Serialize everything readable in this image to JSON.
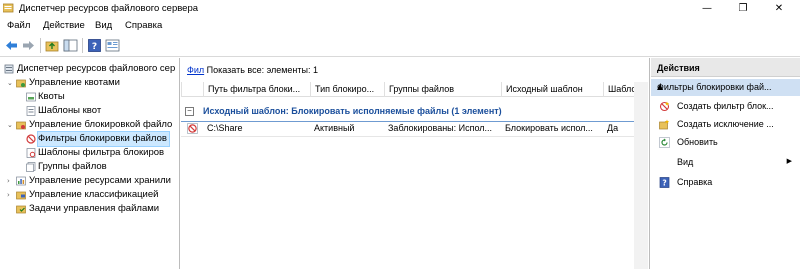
{
  "window": {
    "title": "Диспетчер ресурсов файлового сервера",
    "minimize": "—",
    "maximize": "❐",
    "close": "✕"
  },
  "menu": [
    "Файл",
    "Действие",
    "Вид",
    "Справка"
  ],
  "toolbar": [
    "back-icon",
    "forward-icon",
    "up-folder-icon",
    "show-hide-tree-icon",
    "help-icon",
    "properties-icon"
  ],
  "tree": {
    "root": "Диспетчер ресурсов файлового сер",
    "quota_mgmt": "Управление квотами",
    "quotas": "Квоты",
    "quota_templates": "Шаблоны квот",
    "screening_mgmt": "Управление блокировкой файло",
    "file_screens": "Фильтры блокировки файлов",
    "file_screen_templates": "Шаблоны фильтра блокиров",
    "file_groups": "Группы файлов",
    "storage_reports": "Управление ресурсами хранили",
    "classification": "Управление классификацией",
    "file_tasks": "Задачи управления файлами"
  },
  "center": {
    "filter_link": "Фил",
    "filter_text": "Показать все: элементы: 1",
    "columns": [
      "Путь фильтра блоки...",
      "Тип блокиро...",
      "Группы файлов",
      "Исходный шаблон",
      "Шабло..."
    ],
    "group_header": "Исходный шаблон: Блокировать исполняемые файлы (1 элемент)",
    "group_toggle": "−",
    "rows": [
      {
        "path": "C:\\Share",
        "type": "Активный",
        "groups": "Заблокированы: Испол...",
        "template": "Блокировать испол...",
        "match": "Да"
      }
    ]
  },
  "actions": {
    "header": "Действия",
    "section": "Фильтры блокировки фай...",
    "section_arrow": "▲",
    "items": [
      {
        "label": "Создать фильтр блок...",
        "icon": "create-file-screen-icon"
      },
      {
        "label": "Создать исключение ...",
        "icon": "create-exception-icon"
      },
      {
        "label": "Обновить",
        "icon": "refresh-icon"
      },
      {
        "label": "Вид",
        "icon": "view-icon"
      },
      {
        "label": "Справка",
        "icon": "help-icon"
      }
    ],
    "submenu_arrow": "▶"
  }
}
